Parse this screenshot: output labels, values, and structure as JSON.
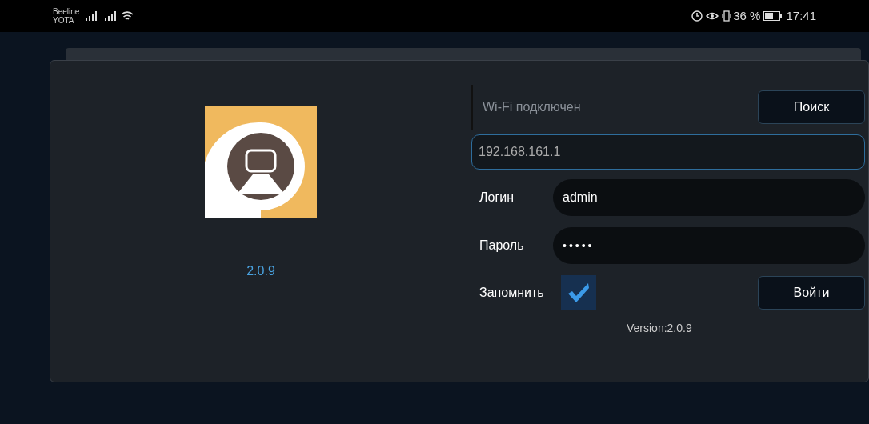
{
  "status_bar": {
    "carriers": [
      "Beeline",
      "YOTA"
    ],
    "battery": "36 %",
    "time": "17:41"
  },
  "app": {
    "version_label": "2.0.9"
  },
  "login": {
    "wifi_status": "Wi-Fi подключен",
    "search_button": "Поиск",
    "address": "192.168.161.1",
    "fields": [
      {
        "label": "Логин",
        "value": "admin",
        "kind": "text"
      },
      {
        "label": "Пароль",
        "value": "•••••",
        "kind": "password"
      }
    ],
    "remember": {
      "label": "Запомнить",
      "checked": true
    },
    "login_button": "Войти",
    "version": "Version:2.0.9"
  }
}
